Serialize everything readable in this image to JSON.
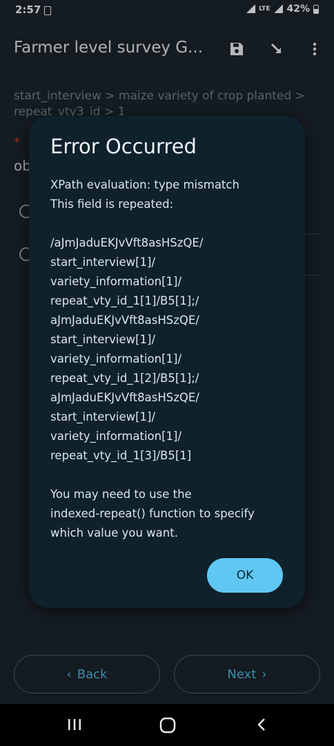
{
  "status_bar": {
    "time": "2:57",
    "network": "LTE",
    "battery": "42%"
  },
  "toolbar": {
    "title": "Farmer level survey G...",
    "save_icon": "save-icon",
    "send_icon": "download-arrow-icon",
    "menu_icon": "more-vert-icon"
  },
  "form": {
    "breadcrumb_line1": "start_interview > maize variety of crop planted >",
    "breadcrumb_line2": "repeat_vty3_id > 1",
    "required_mark": "*",
    "question_partial": "ob"
  },
  "dialog": {
    "title": "Error Occurred",
    "lines": [
      "XPath evaluation: type mismatch",
      "This field is repeated:",
      "/aJmJaduEKJvVft8asHSzQE/",
      "start_interview[1]/",
      "variety_information[1]/",
      "repeat_vty_id_1[1]/B5[1];/",
      "aJmJaduEKJvVft8asHSzQE/",
      "start_interview[1]/",
      "variety_information[1]/",
      "repeat_vty_id_1[2]/B5[1];/",
      "aJmJaduEKJvVft8asHSzQE/",
      "start_interview[1]/",
      "variety_information[1]/",
      "repeat_vty_id_1[3]/B5[1]",
      "You may need to use the",
      "indexed-repeat() function to specify",
      "which value you want."
    ],
    "ok_label": "OK"
  },
  "navigation": {
    "back_label": "Back",
    "next_label": "Next"
  },
  "colors": {
    "background": "#1b252c",
    "dialog_bg": "#0f212b",
    "accent": "#5fc7f2",
    "nav_text": "#3a8eaf",
    "required": "#e53935"
  }
}
